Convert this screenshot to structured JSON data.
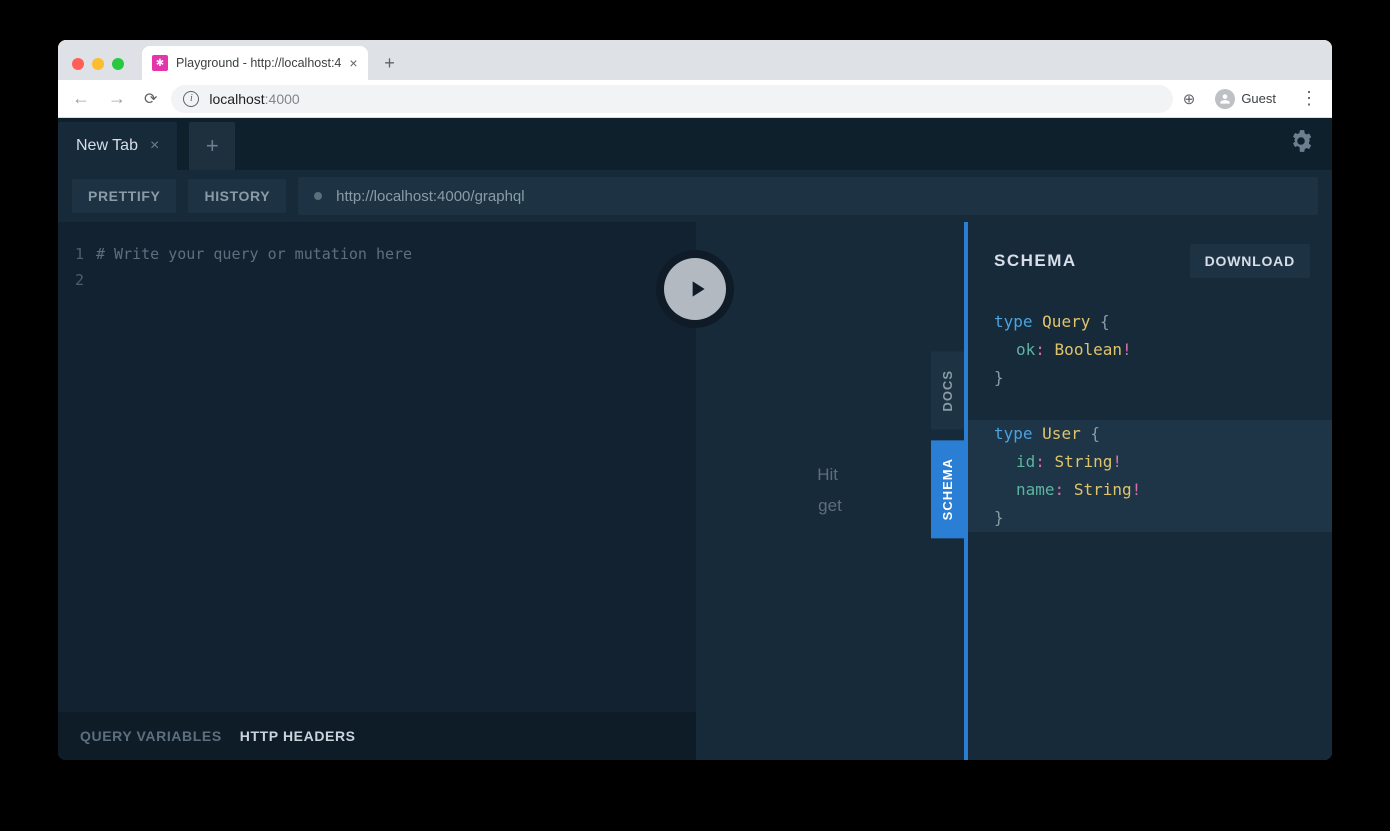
{
  "browser": {
    "tab_title": "Playground - http://localhost:4",
    "url_host": "localhost",
    "url_port": ":4000",
    "profile_label": "Guest"
  },
  "playground": {
    "tab_label": "New Tab",
    "toolbar": {
      "prettify": "PRETTIFY",
      "history": "HISTORY",
      "endpoint": "http://localhost:4000/graphql"
    },
    "editor": {
      "line_numbers": [
        "1",
        "2"
      ],
      "placeholder_comment": "# Write your query or mutation here"
    },
    "result_placeholder": "Hit \nget",
    "bottom_tabs": {
      "query_variables": "QUERY VARIABLES",
      "http_headers": "HTTP HEADERS"
    },
    "side_tabs": {
      "docs": "DOCS",
      "schema": "SCHEMA"
    },
    "schema_panel": {
      "title": "SCHEMA",
      "download": "DOWNLOAD",
      "types": [
        {
          "keyword": "type",
          "name": "Query",
          "fields": [
            {
              "name": "ok",
              "type": "Boolean",
              "non_null": true
            }
          ],
          "highlighted": false
        },
        {
          "keyword": "type",
          "name": "User",
          "fields": [
            {
              "name": "id",
              "type": "String",
              "non_null": true
            },
            {
              "name": "name",
              "type": "String",
              "non_null": true
            }
          ],
          "highlighted": true
        }
      ]
    }
  }
}
